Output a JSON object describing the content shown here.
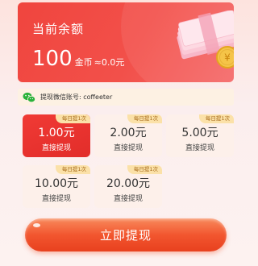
{
  "balance": {
    "title": "当前余额",
    "amount": "100",
    "unit": "金币",
    "approx": "≈0.0元"
  },
  "wechat": {
    "label": "提现微信账号: coffeeter",
    "icon": "wechat-icon"
  },
  "options": [
    {
      "amount": "1.00元",
      "sub": "直接提现",
      "badge": "每日提1次",
      "selected": true
    },
    {
      "amount": "2.00元",
      "sub": "直接提现",
      "badge": "每日提1次",
      "selected": false
    },
    {
      "amount": "5.00元",
      "sub": "直接提现",
      "badge": "每日提1次",
      "selected": false
    },
    {
      "amount": "10.00元",
      "sub": "直接提现",
      "badge": "每日提1次",
      "selected": false
    },
    {
      "amount": "20.00元",
      "sub": "直接提现",
      "badge": "每日提1次",
      "selected": false
    }
  ],
  "button": {
    "label": "立即提现"
  },
  "colors": {
    "accent": "#f0453e",
    "badge": "#fbe1a8",
    "wechat_green": "#2ab23b",
    "option_bg": "#fdf0ea"
  }
}
